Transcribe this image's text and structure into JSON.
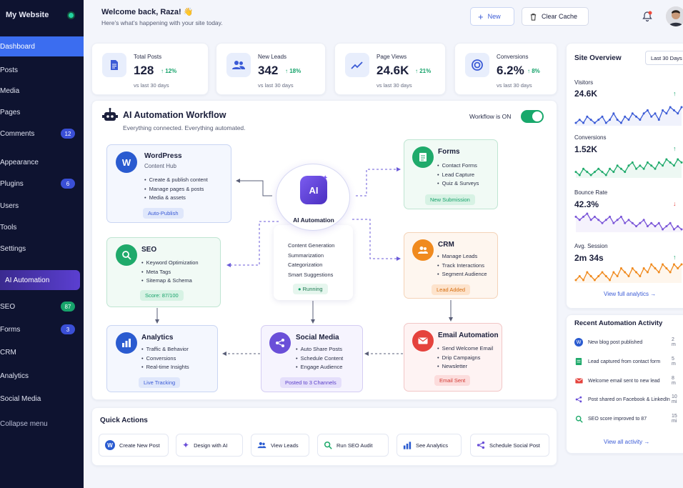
{
  "sidebar": {
    "site_name": "My Website",
    "items": [
      {
        "label": "Dashboard"
      },
      {
        "label": "Posts"
      },
      {
        "label": "Media"
      },
      {
        "label": "Pages"
      },
      {
        "label": "Comments",
        "badge": "12"
      },
      {
        "label": "Appearance"
      },
      {
        "label": "Plugins",
        "badge": "6"
      },
      {
        "label": "Users"
      },
      {
        "label": "Tools"
      },
      {
        "label": "Settings"
      },
      {
        "label": "AI Automation"
      },
      {
        "label": "SEO",
        "badge": "87"
      },
      {
        "label": "Forms",
        "badge": "3"
      },
      {
        "label": "CRM"
      },
      {
        "label": "Analytics"
      },
      {
        "label": "Social Media"
      },
      {
        "label": "Collapse menu"
      }
    ]
  },
  "header": {
    "welcome": "Welcome back, Raza! 👋",
    "subtitle": "Here’s what’s happening with your site today.",
    "new_label": "New",
    "clear_cache_label": "Clear Cache"
  },
  "stats": [
    {
      "title": "Total Posts",
      "value": "128",
      "delta": "12%",
      "caption": "vs last 30 days"
    },
    {
      "title": "New Leads",
      "value": "342",
      "delta": "18%",
      "caption": "vs last 30 days"
    },
    {
      "title": "Page Views",
      "value": "24.6K",
      "delta": "21%",
      "caption": "vs last 30 days"
    },
    {
      "title": "Conversions",
      "value": "6.2%",
      "delta": "8%",
      "caption": "vs last 30 days"
    }
  ],
  "workflow": {
    "title": "AI Automation Workflow",
    "subtitle": "Everything connected. Everything automated.",
    "toggle_label": "Workflow is ON",
    "center": {
      "icon_text": "AI",
      "title": "AI Automation",
      "items": [
        "Content Generation",
        "Summarization",
        "Categorization",
        "Smart Suggestions"
      ],
      "status": "Running"
    },
    "wordpress": {
      "title": "WordPress",
      "subtitle": "Content Hub",
      "items": [
        "Create & publish content",
        "Manage pages & posts",
        "Media & assets"
      ],
      "pill": "Auto-Publish"
    },
    "seo": {
      "title": "SEO",
      "items": [
        "Keyword Optimization",
        "Meta Tags",
        "Sitemap & Schema"
      ],
      "pill": "Score: 87/100"
    },
    "analytics": {
      "title": "Analytics",
      "items": [
        "Traffic & Behavior",
        "Conversions",
        "Real-time Insights"
      ],
      "pill": "Live Tracking"
    },
    "social": {
      "title": "Social Media",
      "items": [
        "Auto Share Posts",
        "Schedule Content",
        "Engage Audience"
      ],
      "pill": "Posted to 3 Channels"
    },
    "forms": {
      "title": "Forms",
      "items": [
        "Contact Forms",
        "Lead Capture",
        "Quiz & Surveys"
      ],
      "pill": "New Submission"
    },
    "crm": {
      "title": "CRM",
      "items": [
        "Manage Leads",
        "Track Interactions",
        "Segment Audience"
      ],
      "pill": "Lead Added"
    },
    "email": {
      "title": "Email Automation",
      "items": [
        "Send Welcome Email",
        "Drip Campaigns",
        "Newsletter"
      ],
      "pill": "Email Sent"
    }
  },
  "quick_actions": {
    "title": "Quick Actions",
    "items": [
      "Create New Post",
      "Design with AI",
      "View Leads",
      "Run SEO Audit",
      "See Analytics",
      "Schedule Social Post"
    ]
  },
  "overview": {
    "title": "Site Overview",
    "range": "Last 30 Days",
    "metrics": [
      {
        "label": "Visitors",
        "value": "24.6K",
        "trend": "up",
        "color": "#3b5bd6",
        "values": [
          5,
          6,
          5,
          7,
          6,
          5,
          6,
          7,
          5,
          6,
          8,
          6,
          5,
          7,
          6,
          8,
          7,
          6,
          8,
          9,
          7,
          8,
          6,
          9,
          8,
          10,
          9,
          8,
          10
        ]
      },
      {
        "label": "Conversions",
        "value": "1.52K",
        "trend": "up",
        "color": "#1faa6b",
        "values": [
          4,
          3,
          5,
          4,
          3,
          4,
          5,
          4,
          3,
          5,
          4,
          6,
          5,
          4,
          6,
          7,
          5,
          6,
          5,
          7,
          6,
          5,
          7,
          6,
          8,
          7,
          6,
          8,
          7
        ]
      },
      {
        "label": "Bounce Rate",
        "value": "42.3%",
        "trend": "down",
        "color": "#7a55d8",
        "values": [
          7,
          6,
          7,
          8,
          6,
          7,
          6,
          5,
          6,
          7,
          5,
          6,
          7,
          5,
          6,
          5,
          4,
          5,
          6,
          4,
          5,
          4,
          5,
          3,
          4,
          5,
          3,
          4,
          3
        ]
      },
      {
        "label": "Avg. Session",
        "value": "2m 34s",
        "trend": "up",
        "color": "#f08a1e",
        "values": [
          3,
          4,
          3,
          5,
          4,
          3,
          4,
          5,
          4,
          3,
          5,
          4,
          6,
          5,
          4,
          6,
          5,
          4,
          6,
          5,
          7,
          6,
          5,
          7,
          6,
          5,
          7,
          6,
          7
        ]
      }
    ],
    "link": "View full analytics →"
  },
  "activity": {
    "title": "Recent Automation Activity",
    "items": [
      {
        "text": "New blog post published",
        "time": "2 m"
      },
      {
        "text": "Lead captured from contact form",
        "time": "5 m"
      },
      {
        "text": "Welcome email sent to new lead",
        "time": "8 m"
      },
      {
        "text": "Post shared on Facebook & LinkedIn",
        "time": "10 mi"
      },
      {
        "text": "SEO score improved to 87",
        "time": "15 mi"
      }
    ],
    "link": "View all activity →"
  },
  "colors": {
    "sidebar": "#0e1330",
    "accent": "#3b6df0",
    "green": "#17a36b"
  }
}
